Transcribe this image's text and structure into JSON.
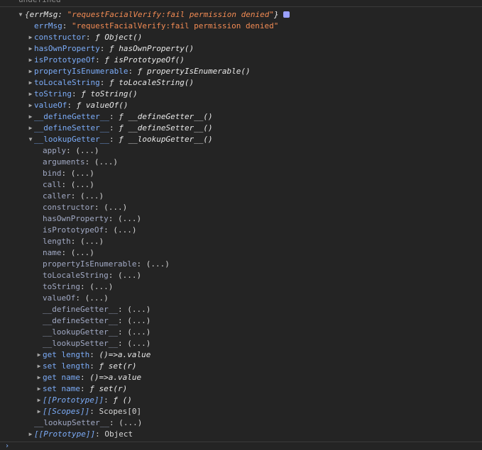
{
  "top_text": "undefined",
  "header": {
    "open_brace": "{",
    "key": "errMsg",
    "colon": ": ",
    "value": "\"requestFacialVerify:fail permission denied\"",
    "close_brace": "}"
  },
  "rows": [
    {
      "key": "errMsg",
      "sep": ": ",
      "value": "\"requestFacialVerify:fail permission denied\"",
      "type": "str",
      "arrow": "none",
      "indent": 1
    },
    {
      "key": "constructor",
      "sep": ": ",
      "f": "ƒ ",
      "value": "Object()",
      "type": "func",
      "arrow": "right",
      "indent": 1
    },
    {
      "key": "hasOwnProperty",
      "sep": ": ",
      "f": "ƒ ",
      "value": "hasOwnProperty()",
      "type": "func",
      "arrow": "right",
      "indent": 1
    },
    {
      "key": "isPrototypeOf",
      "sep": ": ",
      "f": "ƒ ",
      "value": "isPrototypeOf()",
      "type": "func",
      "arrow": "right",
      "indent": 1
    },
    {
      "key": "propertyIsEnumerable",
      "sep": ": ",
      "f": "ƒ ",
      "value": "propertyIsEnumerable()",
      "type": "func",
      "arrow": "right",
      "indent": 1
    },
    {
      "key": "toLocaleString",
      "sep": ": ",
      "f": "ƒ ",
      "value": "toLocaleString()",
      "type": "func",
      "arrow": "right",
      "indent": 1
    },
    {
      "key": "toString",
      "sep": ": ",
      "f": "ƒ ",
      "value": "toString()",
      "type": "func",
      "arrow": "right",
      "indent": 1
    },
    {
      "key": "valueOf",
      "sep": ": ",
      "f": "ƒ ",
      "value": "valueOf()",
      "type": "func",
      "arrow": "right",
      "indent": 1
    },
    {
      "key": "__defineGetter__",
      "sep": ": ",
      "f": "ƒ ",
      "value": "__defineGetter__()",
      "type": "func",
      "arrow": "right",
      "indent": 1
    },
    {
      "key": "__defineSetter__",
      "sep": ": ",
      "f": "ƒ ",
      "value": "__defineSetter__()",
      "type": "func",
      "arrow": "right",
      "indent": 1
    },
    {
      "key": "__lookupGetter__",
      "sep": ": ",
      "f": "ƒ ",
      "value": "__lookupGetter__()",
      "type": "func",
      "arrow": "down",
      "indent": 1
    },
    {
      "key": "apply",
      "sep": ": ",
      "value": "(...)",
      "type": "ellipsis",
      "arrow": "none",
      "indent": 2
    },
    {
      "key": "arguments",
      "sep": ": ",
      "value": "(...)",
      "type": "ellipsis",
      "arrow": "none",
      "indent": 2
    },
    {
      "key": "bind",
      "sep": ": ",
      "value": "(...)",
      "type": "ellipsis",
      "arrow": "none",
      "indent": 2
    },
    {
      "key": "call",
      "sep": ": ",
      "value": "(...)",
      "type": "ellipsis",
      "arrow": "none",
      "indent": 2
    },
    {
      "key": "caller",
      "sep": ": ",
      "value": "(...)",
      "type": "ellipsis",
      "arrow": "none",
      "indent": 2
    },
    {
      "key": "constructor",
      "sep": ": ",
      "value": "(...)",
      "type": "ellipsis",
      "arrow": "none",
      "indent": 2
    },
    {
      "key": "hasOwnProperty",
      "sep": ": ",
      "value": "(...)",
      "type": "ellipsis",
      "arrow": "none",
      "indent": 2
    },
    {
      "key": "isPrototypeOf",
      "sep": ": ",
      "value": "(...)",
      "type": "ellipsis",
      "arrow": "none",
      "indent": 2
    },
    {
      "key": "length",
      "sep": ": ",
      "value": "(...)",
      "type": "ellipsis",
      "arrow": "none",
      "indent": 2
    },
    {
      "key": "name",
      "sep": ": ",
      "value": "(...)",
      "type": "ellipsis",
      "arrow": "none",
      "indent": 2
    },
    {
      "key": "propertyIsEnumerable",
      "sep": ": ",
      "value": "(...)",
      "type": "ellipsis",
      "arrow": "none",
      "indent": 2
    },
    {
      "key": "toLocaleString",
      "sep": ": ",
      "value": "(...)",
      "type": "ellipsis",
      "arrow": "none",
      "indent": 2
    },
    {
      "key": "toString",
      "sep": ": ",
      "value": "(...)",
      "type": "ellipsis",
      "arrow": "none",
      "indent": 2
    },
    {
      "key": "valueOf",
      "sep": ": ",
      "value": "(...)",
      "type": "ellipsis",
      "arrow": "none",
      "indent": 2
    },
    {
      "key": "__defineGetter__",
      "sep": ": ",
      "value": "(...)",
      "type": "ellipsis",
      "arrow": "none",
      "indent": 2
    },
    {
      "key": "__defineSetter__",
      "sep": ": ",
      "value": "(...)",
      "type": "ellipsis",
      "arrow": "none",
      "indent": 2
    },
    {
      "key": "__lookupGetter__",
      "sep": ": ",
      "value": "(...)",
      "type": "ellipsis",
      "arrow": "none",
      "indent": 2
    },
    {
      "key": "__lookupSetter__",
      "sep": ": ",
      "value": "(...)",
      "type": "ellipsis",
      "arrow": "none",
      "indent": 2
    },
    {
      "key": "get length",
      "sep": ": ",
      "value": "()=>a.value",
      "type": "func",
      "arrow": "right",
      "indent": 2
    },
    {
      "key": "set length",
      "sep": ": ",
      "f": "ƒ ",
      "value": "set(r)",
      "type": "func",
      "arrow": "right",
      "indent": 2
    },
    {
      "key": "get name",
      "sep": ": ",
      "value": "()=>a.value",
      "type": "func",
      "arrow": "right",
      "indent": 2
    },
    {
      "key": "set name",
      "sep": ": ",
      "f": "ƒ ",
      "value": "set(r)",
      "type": "func",
      "arrow": "right",
      "indent": 2
    },
    {
      "key": "[[Prototype]]",
      "sep": ": ",
      "f": "ƒ ",
      "value": "()",
      "type": "proto-func",
      "arrow": "right",
      "indent": 2
    },
    {
      "key": "[[Scopes]]",
      "sep": ": ",
      "value": "Scopes[0]",
      "type": "proto-obj",
      "arrow": "right",
      "indent": 2
    },
    {
      "key": "__lookupSetter__",
      "sep": ": ",
      "value": "(...)",
      "type": "ellipsis",
      "arrow": "none",
      "indent": 1
    },
    {
      "key": "[[Prototype]]",
      "sep": ": ",
      "value": "Object",
      "type": "proto-obj",
      "arrow": "right",
      "indent": 1
    }
  ],
  "bottom_prompt": "›",
  "icons": {
    "expanded": "triangle-down-icon",
    "collapsed": "triangle-right-icon",
    "info": "info-badge-icon"
  },
  "colors": {
    "background": "#242424",
    "key": "#7cacf8",
    "string": "#f28b54",
    "text": "#d5d5d5",
    "badge": "#9aa0ff"
  }
}
